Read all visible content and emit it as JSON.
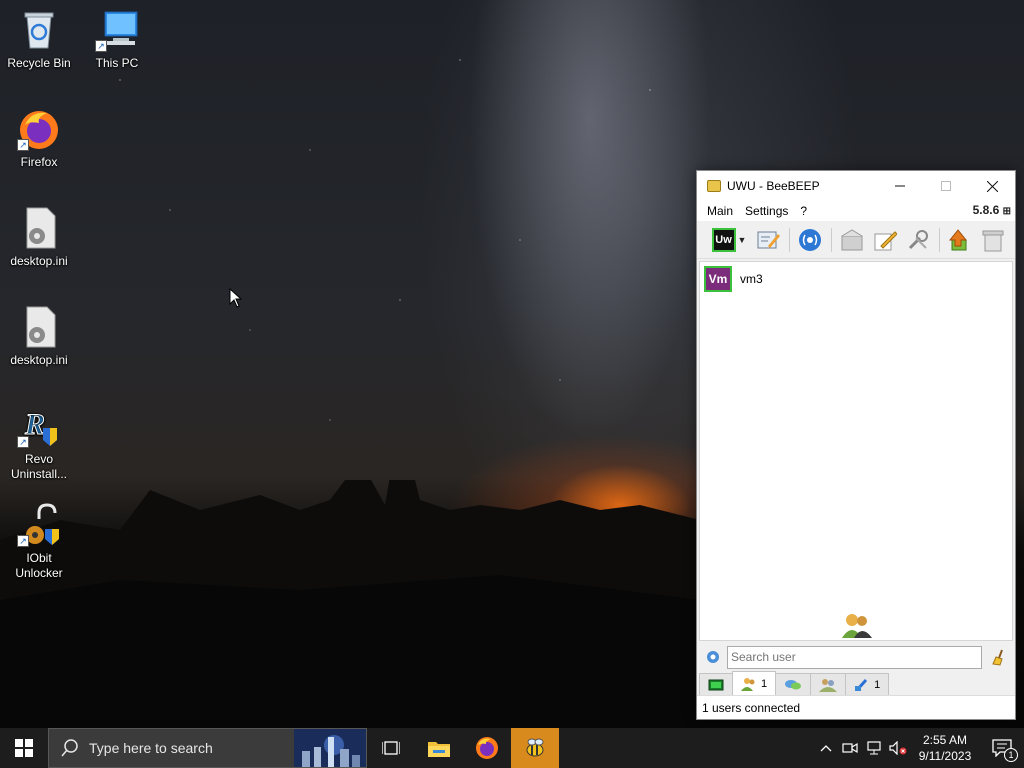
{
  "desktop": {
    "icons": [
      {
        "label": "Recycle Bin"
      },
      {
        "label": "This PC"
      },
      {
        "label": "Firefox"
      },
      {
        "label": "desktop.ini"
      },
      {
        "label": "desktop.ini"
      },
      {
        "label": "Revo Uninstall..."
      },
      {
        "label": "IObit Unlocker"
      }
    ]
  },
  "window": {
    "title": "UWU - BeeBEEP",
    "menu": [
      "Main",
      "Settings",
      "?"
    ],
    "version": "5.8.6",
    "toolbar": {
      "status_badge": "Uw"
    },
    "users": [
      {
        "initials": "Vm",
        "name": "vm3"
      }
    ],
    "search": {
      "placeholder": "Search user"
    },
    "tabs": [
      {
        "count": ""
      },
      {
        "count": "1"
      },
      {
        "count": ""
      },
      {
        "count": ""
      },
      {
        "count": "1"
      }
    ],
    "status": "1 users connected"
  },
  "taskbar": {
    "search_placeholder": "Type here to search",
    "clock_time": "2:55 AM",
    "clock_date": "9/11/2023",
    "notification_count": "1"
  },
  "colors": {
    "taskbar_bg": "#1d1d1d",
    "active_app": "#d98a1d",
    "avatar_bg": "#7b2d7b",
    "online_border": "#3cc13c"
  }
}
